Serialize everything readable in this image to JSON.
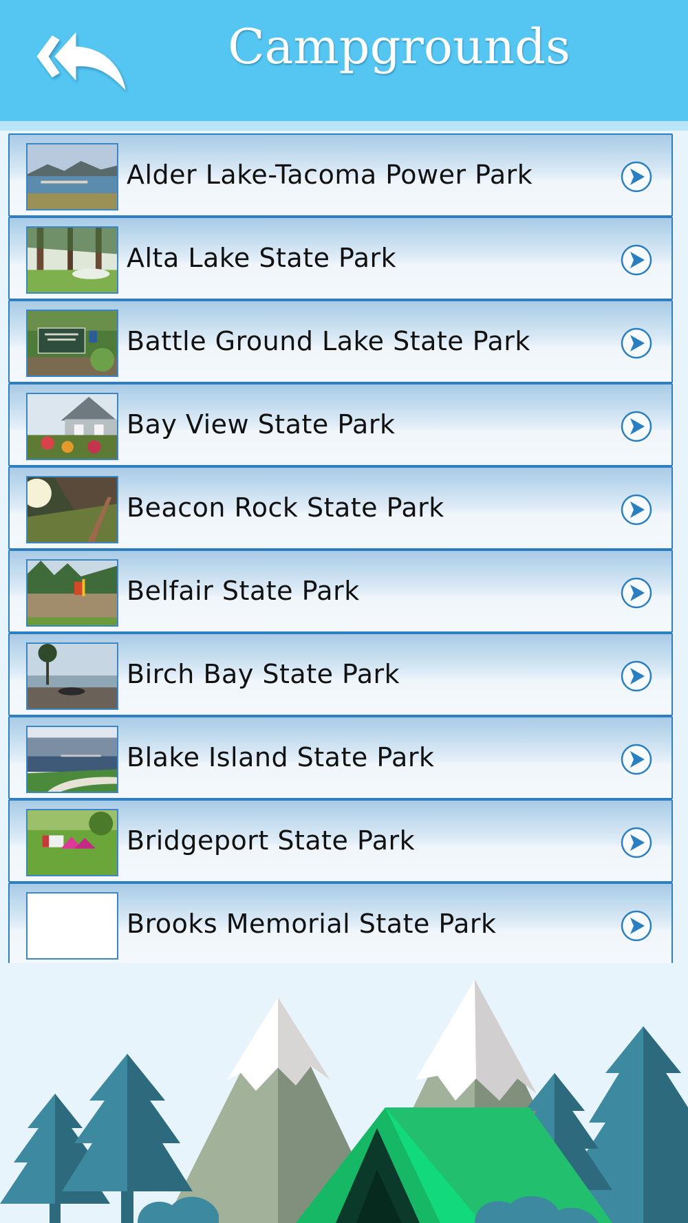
{
  "header": {
    "title": "Campgrounds",
    "back_icon": "double-back-arrow-icon",
    "background_color": "#55c6f2"
  },
  "parks": [
    {
      "name": "Alder Lake-Tacoma Power Park",
      "thumb": "lake-dock"
    },
    {
      "name": "Alta Lake State Park",
      "thumb": "forest-campsite"
    },
    {
      "name": "Battle Ground Lake State Park",
      "thumb": "park-sign"
    },
    {
      "name": "Bay View State Park",
      "thumb": "house-garden"
    },
    {
      "name": "Beacon Rock State Park",
      "thumb": "rock-trail"
    },
    {
      "name": "Belfair State Park",
      "thumb": "playground"
    },
    {
      "name": "Birch Bay State Park",
      "thumb": "beach"
    },
    {
      "name": "Blake Island State Park",
      "thumb": "waterfront"
    },
    {
      "name": "Bridgeport State Park",
      "thumb": "tents-lawn"
    },
    {
      "name": "Brooks Memorial State Park",
      "thumb": "blank"
    }
  ],
  "row_icon": "chevron-right-circle-icon",
  "colors": {
    "accent": "#2f7fc0",
    "tent": "#12d97c",
    "tree": "#3d8aa0"
  }
}
